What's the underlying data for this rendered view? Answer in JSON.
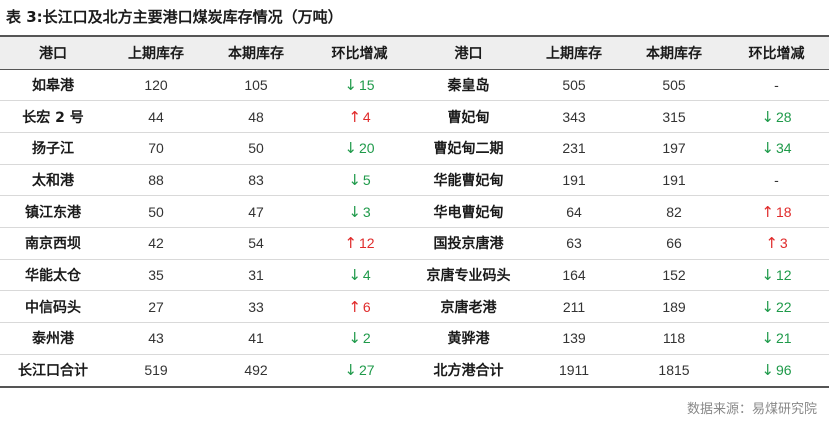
{
  "caption": {
    "prefix": "表 3:",
    "title": "长江口及北方主要港口煤炭库存情况（万吨）"
  },
  "headers": [
    "港口",
    "上期库存",
    "本期库存",
    "环比增减",
    "港口",
    "上期库存",
    "本期库存",
    "环比增减"
  ],
  "rows": [
    {
      "left": {
        "port": "如皋港",
        "prev": "120",
        "curr": "105",
        "chg": "15",
        "dir": "down"
      },
      "right": {
        "port": "秦皇岛",
        "prev": "505",
        "curr": "505",
        "chg": "-",
        "dir": "flat"
      }
    },
    {
      "left": {
        "port": "长宏 2 号",
        "prev": "44",
        "curr": "48",
        "chg": "4",
        "dir": "up"
      },
      "right": {
        "port": "曹妃甸",
        "prev": "343",
        "curr": "315",
        "chg": "28",
        "dir": "down"
      }
    },
    {
      "left": {
        "port": "扬子江",
        "prev": "70",
        "curr": "50",
        "chg": "20",
        "dir": "down"
      },
      "right": {
        "port": "曹妃甸二期",
        "prev": "231",
        "curr": "197",
        "chg": "34",
        "dir": "down"
      }
    },
    {
      "left": {
        "port": "太和港",
        "prev": "88",
        "curr": "83",
        "chg": "5",
        "dir": "down"
      },
      "right": {
        "port": "华能曹妃甸",
        "prev": "191",
        "curr": "191",
        "chg": "-",
        "dir": "flat"
      }
    },
    {
      "left": {
        "port": "镇江东港",
        "prev": "50",
        "curr": "47",
        "chg": "3",
        "dir": "down"
      },
      "right": {
        "port": "华电曹妃甸",
        "prev": "64",
        "curr": "82",
        "chg": "18",
        "dir": "up"
      }
    },
    {
      "left": {
        "port": "南京西坝",
        "prev": "42",
        "curr": "54",
        "chg": "12",
        "dir": "up"
      },
      "right": {
        "port": "国投京唐港",
        "prev": "63",
        "curr": "66",
        "chg": "3",
        "dir": "up"
      }
    },
    {
      "left": {
        "port": "华能太仓",
        "prev": "35",
        "curr": "31",
        "chg": "4",
        "dir": "down"
      },
      "right": {
        "port": "京唐专业码头",
        "prev": "164",
        "curr": "152",
        "chg": "12",
        "dir": "down"
      }
    },
    {
      "left": {
        "port": "中信码头",
        "prev": "27",
        "curr": "33",
        "chg": "6",
        "dir": "up"
      },
      "right": {
        "port": "京唐老港",
        "prev": "211",
        "curr": "189",
        "chg": "22",
        "dir": "down"
      }
    },
    {
      "left": {
        "port": "泰州港",
        "prev": "43",
        "curr": "41",
        "chg": "2",
        "dir": "down"
      },
      "right": {
        "port": "黄骅港",
        "prev": "139",
        "curr": "118",
        "chg": "21",
        "dir": "down"
      }
    }
  ],
  "total": {
    "left": {
      "port": "长江口合计",
      "prev": "519",
      "curr": "492",
      "chg": "27",
      "dir": "down"
    },
    "right": {
      "port": "北方港合计",
      "prev": "1911",
      "curr": "1815",
      "chg": "96",
      "dir": "down"
    }
  },
  "source": "数据来源：易煤研究院",
  "colors": {
    "up": "#e02b2b",
    "down": "#1f9a4a",
    "header_bg": "#eeeeee"
  },
  "icons": {
    "up": "arrow-up-icon",
    "down": "arrow-down-icon"
  }
}
